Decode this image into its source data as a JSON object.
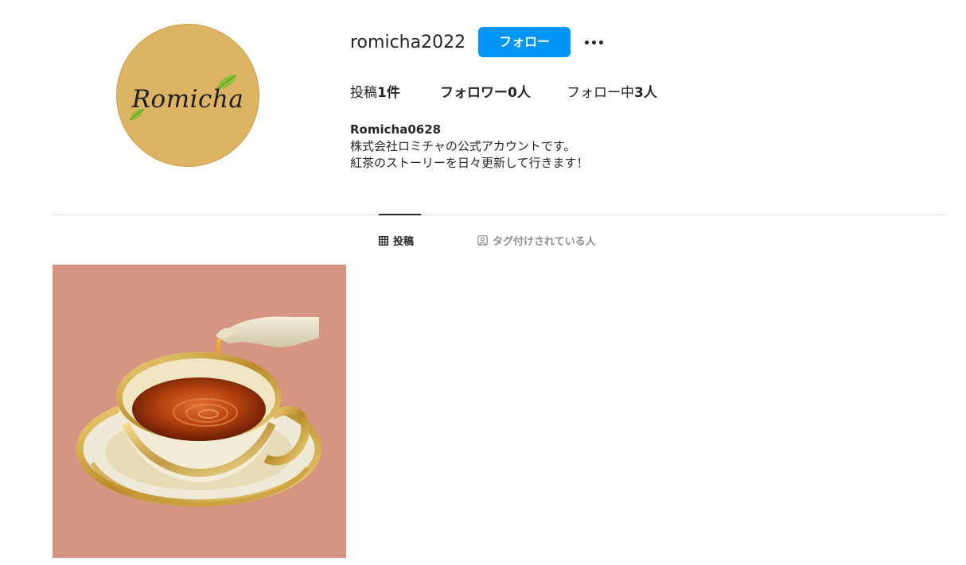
{
  "profile": {
    "username": "romicha2022",
    "follow_label": "フォロー",
    "avatar_logo_text": "Romicha"
  },
  "stats": {
    "posts_label": "投稿",
    "posts_count": "1件",
    "followers_label": "フォロワー",
    "followers_count": "0人",
    "following_label": "フォロー中",
    "following_count": "3人"
  },
  "bio": {
    "name": "Romicha0628",
    "line1": "株式会社ロミチャの公式アカウントです。",
    "line2": "紅茶のストーリーを日々更新して行きます！"
  },
  "tabs": [
    {
      "label": "投稿",
      "icon": "grid-icon",
      "active": true
    },
    {
      "label": "タグ付けされている人",
      "icon": "tagged-user-icon",
      "active": false
    }
  ],
  "colors": {
    "follow_button": "#0095f6",
    "avatar_background": "#dcb463",
    "post_background": "#d69482",
    "leaf": "#8bbf3a"
  }
}
